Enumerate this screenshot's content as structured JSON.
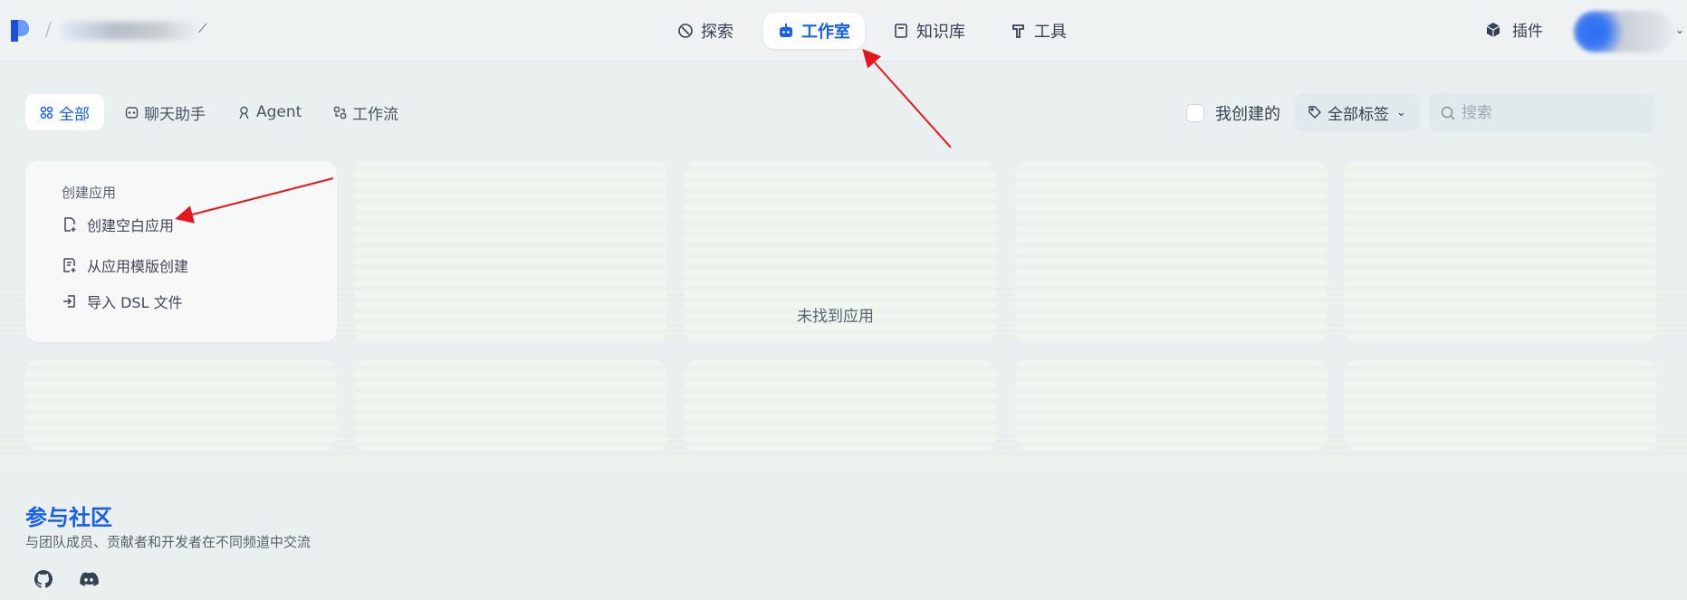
{
  "header": {
    "nav": [
      {
        "id": "explore",
        "label": "探索",
        "icon": "compass-icon"
      },
      {
        "id": "studio",
        "label": "工作室",
        "icon": "robot-icon",
        "active": true
      },
      {
        "id": "knowledge",
        "label": "知识库",
        "icon": "book-icon"
      },
      {
        "id": "tools",
        "label": "工具",
        "icon": "hammer-icon"
      }
    ],
    "plugin_label": "插件"
  },
  "filters": {
    "tabs": [
      {
        "label": "全部",
        "icon": "grid-icon",
        "active": true
      },
      {
        "label": "聊天助手",
        "icon": "chat-icon"
      },
      {
        "label": "Agent",
        "icon": "agent-icon"
      },
      {
        "label": "工作流",
        "icon": "workflow-icon"
      }
    ],
    "mine_label": "我创建的",
    "tags_label": "全部标签",
    "search_placeholder": "搜索"
  },
  "create_card": {
    "title": "创建应用",
    "items": [
      {
        "label": "创建空白应用",
        "icon": "new-file-icon"
      },
      {
        "label": "从应用模版创建",
        "icon": "template-icon"
      },
      {
        "label": "导入 DSL 文件",
        "icon": "import-icon"
      }
    ]
  },
  "empty_state": "未找到应用",
  "footer": {
    "title": "参与社区",
    "subtitle": "与团队成员、贡献者和开发者在不同频道中交流",
    "links": [
      {
        "icon": "github-icon"
      },
      {
        "icon": "discord-icon"
      }
    ]
  },
  "colors": {
    "accent": "#155eef",
    "background": "#eaf0f0",
    "annotation_arrow": "#e8161c"
  }
}
